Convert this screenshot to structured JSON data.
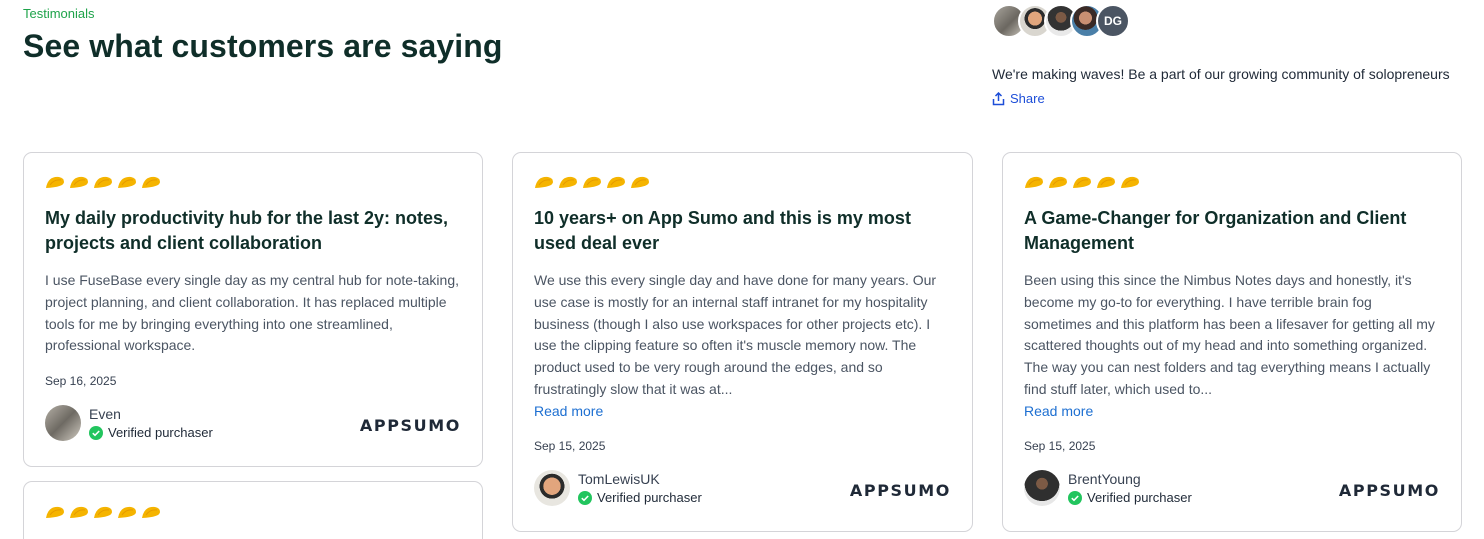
{
  "header": {
    "eyebrow": "Testimonials",
    "title": "See what customers are saying"
  },
  "community": {
    "avatar_initials": "DG",
    "text": "We're making waves! Be a part of our growing community of solopreneurs",
    "share_label": "Share"
  },
  "colors": {
    "accent_green": "#1ea34a",
    "star": "#f5b400",
    "link": "#1d6fd1",
    "verified": "#22c55e"
  },
  "reviews": [
    {
      "rating": 5,
      "title": "My daily productivity hub for the last 2y: notes, projects and client collaboration",
      "body": "I use FuseBase every single day as my central hub for note-taking, project planning, and client collaboration. It has replaced multiple tools for me by bringing everything into one streamlined, professional workspace.",
      "date": "Sep 16, 2025",
      "author": "Even",
      "verified": "Verified purchaser",
      "brand": "APPSUMO"
    },
    {
      "rating": 5,
      "title": "10 years+ on App Sumo and this is my most used deal ever",
      "body": "We use this every single day and have done for many years. Our use case is mostly for an internal staff intranet for my hospitality business (though I also use workspaces for other projects etc). I use the clipping feature so often it's muscle memory now. The product used to be very rough around the edges, and so frustratingly slow that it was at...",
      "read_more": "Read more",
      "date": "Sep 15, 2025",
      "author": "TomLewisUK",
      "verified": "Verified purchaser",
      "brand": "APPSUMO"
    },
    {
      "rating": 5,
      "title": "A Game-Changer for Organization and Client Management",
      "body": "Been using this since the Nimbus Notes days and honestly, it's become my go-to for everything. I have terrible brain fog sometimes and this platform has been a lifesaver for getting all my scattered thoughts out of my head and into something organized. The way you can nest folders and tag everything means I actually find stuff later, which used to...",
      "read_more": "Read more",
      "date": "Sep 15, 2025",
      "author": "BrentYoung",
      "verified": "Verified purchaser",
      "brand": "APPSUMO"
    },
    {
      "rating": 5
    }
  ]
}
